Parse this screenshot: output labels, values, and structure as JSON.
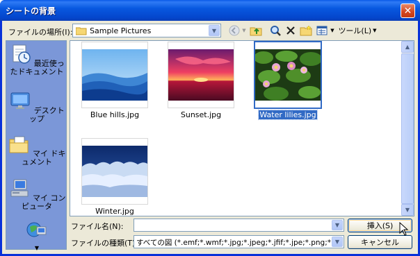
{
  "window": {
    "title": "シートの背景"
  },
  "toolbar": {
    "look_in_label": "ファイルの場所(I):",
    "look_in_value": "Sample Pictures",
    "tools_label": "ツール(L)"
  },
  "places": [
    {
      "label": "最近使ったドキュメント",
      "icon": "recent-documents-icon"
    },
    {
      "label": "デスクトップ",
      "icon": "desktop-icon"
    },
    {
      "label": "マイ ドキュメント",
      "icon": "my-documents-icon"
    },
    {
      "label": "マイ コンピュータ",
      "icon": "my-computer-icon"
    },
    {
      "label": "",
      "icon": "network-places-icon"
    }
  ],
  "files": [
    {
      "name": "Blue hills.jpg",
      "selected": false
    },
    {
      "name": "Sunset.jpg",
      "selected": false
    },
    {
      "name": "Water lilies.jpg",
      "selected": true
    },
    {
      "name": "Winter.jpg",
      "selected": false
    }
  ],
  "filename": {
    "label": "ファイル名(N):",
    "value": ""
  },
  "filetype": {
    "label": "ファイルの種類(T):",
    "value": "すべての図 (*.emf;*.wmf;*.jpg;*.jpeg;*.jfif;*.jpe;*.png;*.bmp"
  },
  "buttons": {
    "insert": "挿入(S)",
    "cancel": "キャンセル"
  }
}
